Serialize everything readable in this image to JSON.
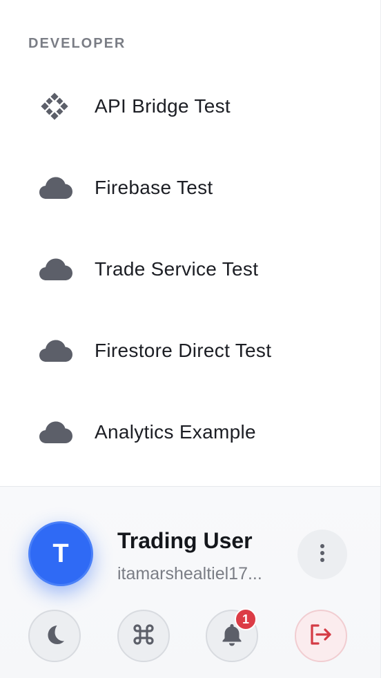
{
  "section": {
    "heading": "DEVELOPER"
  },
  "nav": {
    "items": [
      {
        "label": "API Bridge Test",
        "icon": "api-diamond-icon"
      },
      {
        "label": "Firebase Test",
        "icon": "cloud-icon"
      },
      {
        "label": "Trade Service Test",
        "icon": "cloud-icon"
      },
      {
        "label": "Firestore Direct Test",
        "icon": "cloud-icon"
      },
      {
        "label": "Analytics Example",
        "icon": "cloud-icon"
      }
    ]
  },
  "user": {
    "initial": "T",
    "name": "Trading User",
    "email": "itamarshealtiel17..."
  },
  "actions": {
    "theme_icon": "moon-icon",
    "command_icon": "command-icon",
    "notifications_icon": "bell-icon",
    "notifications_count": "1",
    "logout_icon": "logout-icon",
    "more_icon": "vertical-dots-icon"
  },
  "colors": {
    "accent": "#2f6af5",
    "icon_gray": "#5c5f69",
    "danger": "#d43b45",
    "badge": "#dc3c46"
  }
}
